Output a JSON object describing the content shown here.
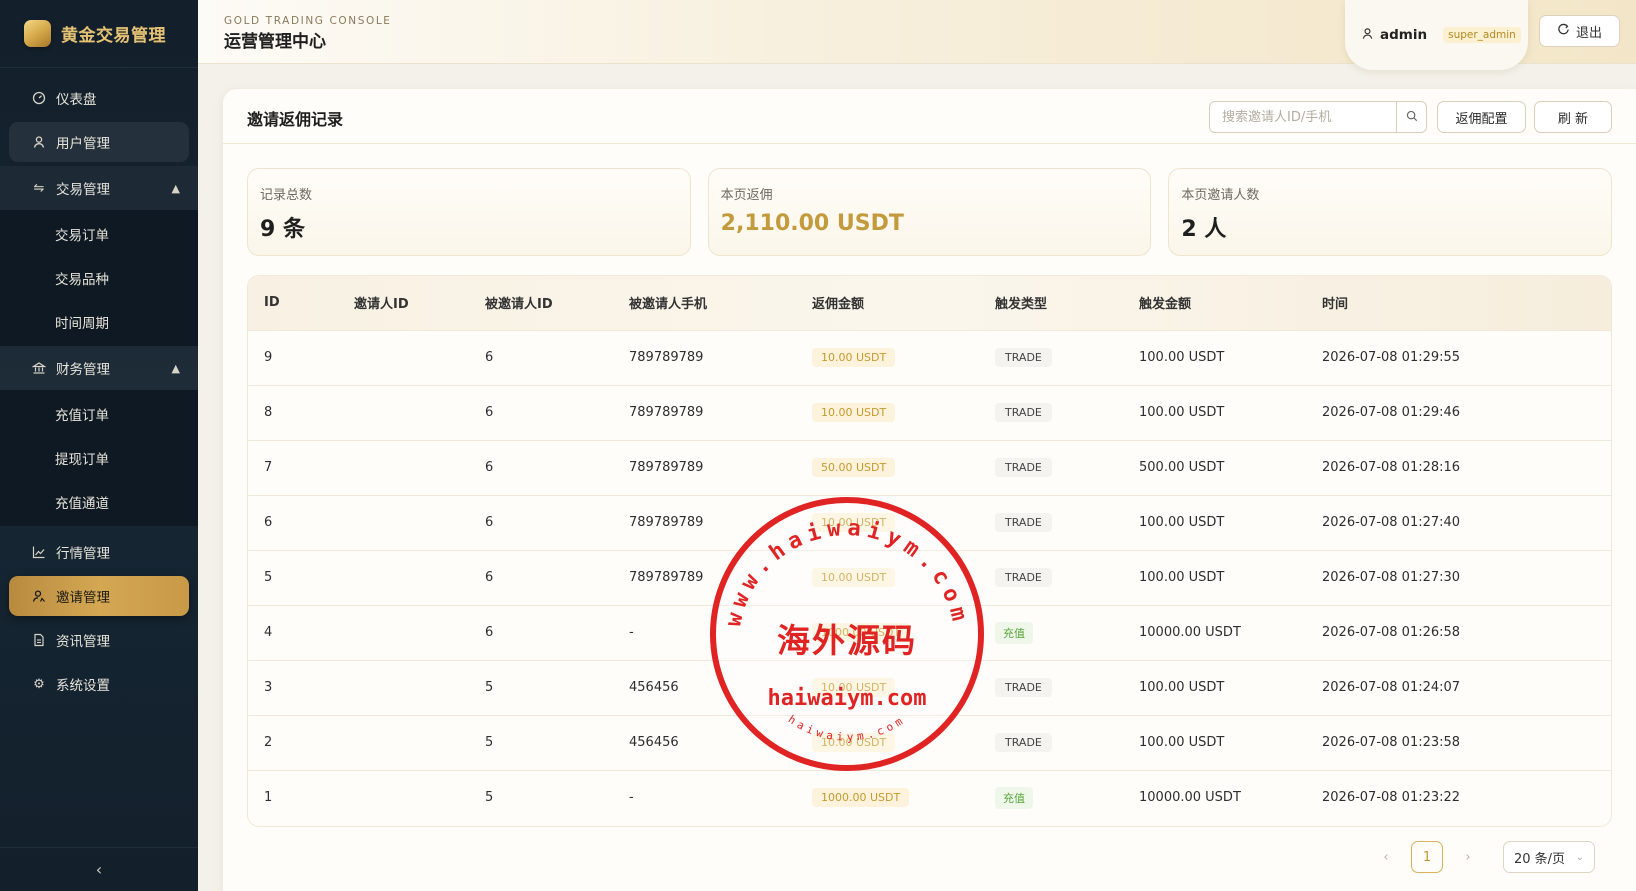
{
  "brand": {
    "title": "黄金交易管理"
  },
  "nav": {
    "dashboard": "仪表盘",
    "users": "用户管理",
    "trade_group": "交易管理",
    "trade_items": [
      "交易订单",
      "交易品种",
      "时间周期"
    ],
    "finance_group": "财务管理",
    "finance_items": [
      "充值订单",
      "提现订单",
      "充值通道"
    ],
    "market": "行情管理",
    "invite": "邀请管理",
    "news": "资讯管理",
    "settings": "系统设置",
    "collapse_icon": "‹"
  },
  "header": {
    "subtitle": "GOLD TRADING CONSOLE",
    "title": "运营管理中心",
    "user": "admin",
    "role": "super_admin",
    "logout": "退出"
  },
  "card": {
    "title": "邀请返佣记录",
    "search_placeholder": "搜索邀请人ID/手机",
    "config_button": "返佣配置",
    "refresh_button": "刷 新"
  },
  "stats": [
    {
      "label": "记录总数",
      "value": "9 条"
    },
    {
      "label": "本页返佣",
      "value": "2,110.00 USDT"
    },
    {
      "label": "本页邀请人数",
      "value": "2 人"
    }
  ],
  "table": {
    "headers": [
      "ID",
      "邀请人ID",
      "被邀请人ID",
      "被邀请人手机",
      "返佣金额",
      "触发类型",
      "触发金额",
      "时间"
    ],
    "rows": [
      {
        "id": "9",
        "inviter": "",
        "invitee": "6",
        "phone": "789789789",
        "amount": "10.00 USDT",
        "type": "TRADE",
        "trigger": "100.00 USDT",
        "time": "2026-07-08 01:29:55"
      },
      {
        "id": "8",
        "inviter": "",
        "invitee": "6",
        "phone": "789789789",
        "amount": "10.00 USDT",
        "type": "TRADE",
        "trigger": "100.00 USDT",
        "time": "2026-07-08 01:29:46"
      },
      {
        "id": "7",
        "inviter": "",
        "invitee": "6",
        "phone": "789789789",
        "amount": "50.00 USDT",
        "type": "TRADE",
        "trigger": "500.00 USDT",
        "time": "2026-07-08 01:28:16"
      },
      {
        "id": "6",
        "inviter": "",
        "invitee": "6",
        "phone": "789789789",
        "amount": "10.00 USDT",
        "type": "TRADE",
        "trigger": "100.00 USDT",
        "time": "2026-07-08 01:27:40"
      },
      {
        "id": "5",
        "inviter": "",
        "invitee": "6",
        "phone": "789789789",
        "amount": "10.00 USDT",
        "type": "TRADE",
        "trigger": "100.00 USDT",
        "time": "2026-07-08 01:27:30"
      },
      {
        "id": "4",
        "inviter": "",
        "invitee": "6",
        "phone": "-",
        "amount": "1000.00 USDT",
        "type": "充值",
        "trigger": "10000.00 USDT",
        "time": "2026-07-08 01:26:58"
      },
      {
        "id": "3",
        "inviter": "",
        "invitee": "5",
        "phone": "456456",
        "amount": "10.00 USDT",
        "type": "TRADE",
        "trigger": "100.00 USDT",
        "time": "2026-07-08 01:24:07"
      },
      {
        "id": "2",
        "inviter": "",
        "invitee": "5",
        "phone": "456456",
        "amount": "10.00 USDT",
        "type": "TRADE",
        "trigger": "100.00 USDT",
        "time": "2026-07-08 01:23:58"
      },
      {
        "id": "1",
        "inviter": "",
        "invitee": "5",
        "phone": "-",
        "amount": "1000.00 USDT",
        "type": "充值",
        "trigger": "10000.00 USDT",
        "time": "2026-07-08 01:23:22"
      }
    ]
  },
  "pagination": {
    "current": "1",
    "page_size": "20 条/页"
  },
  "watermark": {
    "center": "海外源码",
    "domain": "haiwaiym.com",
    "ring_text": "www.haiwaiym.com",
    "small_text": "haiwaiym.com",
    "color": "#e02424"
  }
}
